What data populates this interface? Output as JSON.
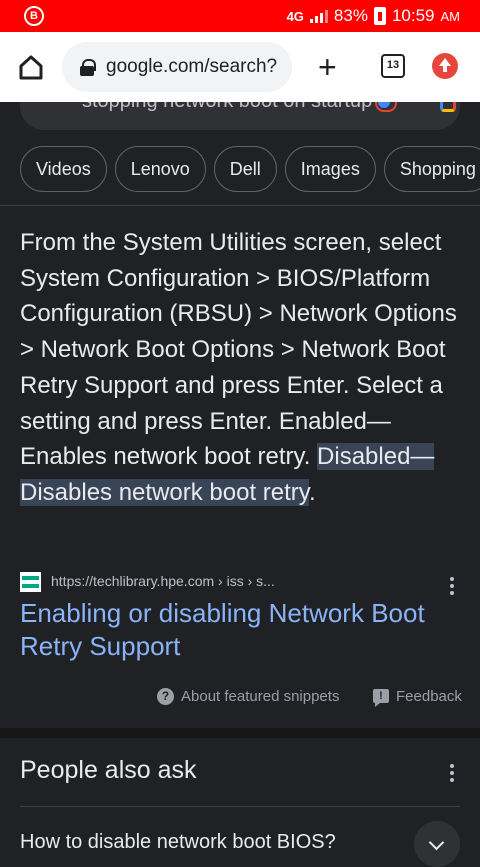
{
  "status": {
    "network": "4G",
    "battery": "83%",
    "time": "10:59",
    "ampm": "AM"
  },
  "browser": {
    "url": "google.com/search?",
    "tab_count": "13"
  },
  "search": {
    "query": "stopping network boot on startup"
  },
  "chips": [
    "Videos",
    "Lenovo",
    "Dell",
    "Images",
    "Shopping"
  ],
  "snippet": {
    "text": "From the System Utilities screen, select System Configuration > BIOS/Platform Configuration (RBSU) > Network Options > Network Boot Options > Network Boot Retry Support and press Enter. Select a setting and press Enter. Enabled—Enables network boot retry. ",
    "highlight": "Disabled—Disables network boot retry",
    "end": "."
  },
  "source": {
    "url": "https://techlibrary.hpe.com",
    "path": " › iss › s..."
  },
  "result": {
    "title": "Enabling or disabling Network Boot Retry Support"
  },
  "footer": {
    "about": "About featured snippets",
    "feedback": "Feedback"
  },
  "paa": {
    "title": "People also ask",
    "question": "How to disable network boot BIOS?"
  },
  "colors": {
    "status_bar": "#ff0000",
    "link": "#8ab4f8",
    "highlight": "#394457",
    "background": "#202124"
  }
}
